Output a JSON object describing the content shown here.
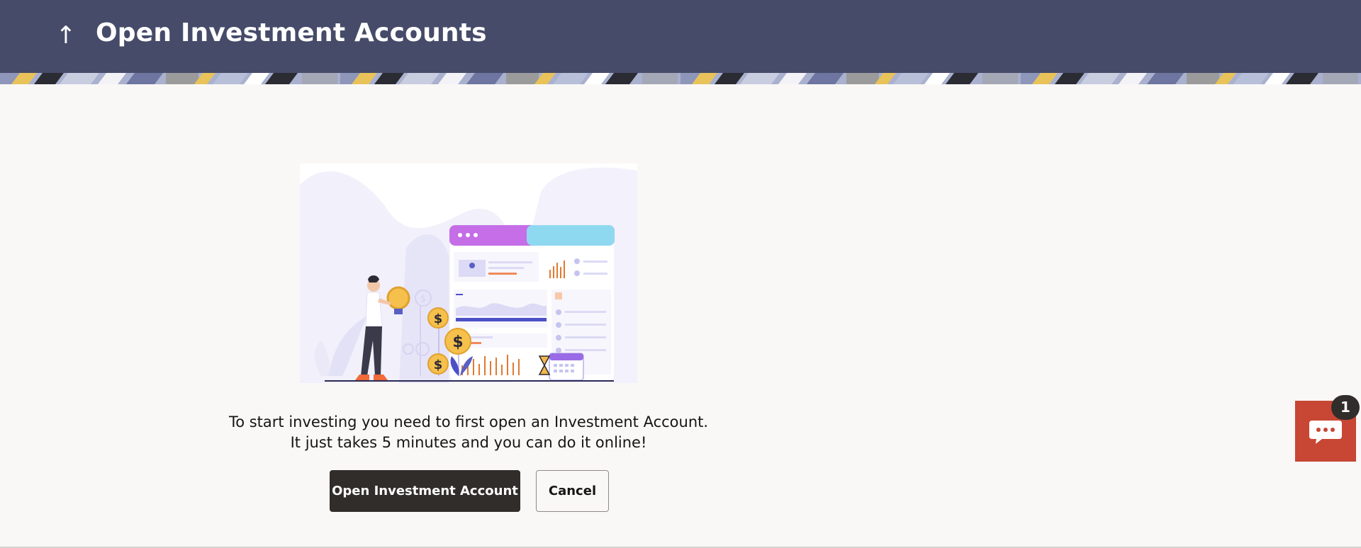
{
  "header": {
    "back_icon": "arrow-up-icon",
    "title": "Open Investment Accounts",
    "background_color": "#464b69"
  },
  "main": {
    "illustration": "investment-illustration",
    "message_line1": "To start investing you need to first open an Investment Account.",
    "message_line2": "It just takes 5 minutes and you can do it online!",
    "primary_button_label": "Open Investment Account",
    "secondary_button_label": "Cancel"
  },
  "chat": {
    "icon": "chat-bubble-icon",
    "badge_count": "1",
    "color": "#c74634"
  }
}
